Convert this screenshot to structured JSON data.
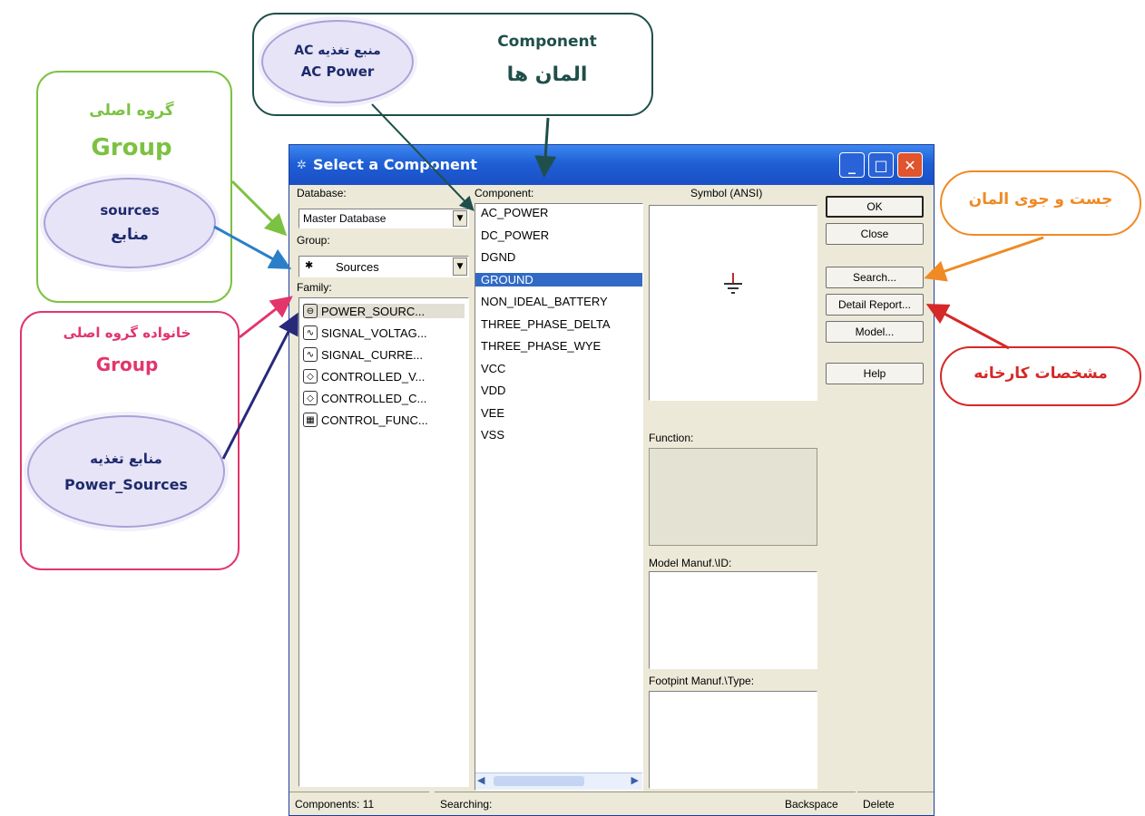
{
  "window": {
    "title": "Select a Component",
    "database_label": "Database:",
    "database_value": "Master Database",
    "group_label": "Group:",
    "group_value": "Sources",
    "family_label": "Family:",
    "component_label": "Component:",
    "symbol_label": "Symbol (ANSI)",
    "function_label": "Function:",
    "model_label": "Model Manuf.\\ID:",
    "footprint_label": "Footpint Manuf.\\Type:",
    "families": [
      {
        "label": "POWER_SOURC...",
        "icon": "power-source-icon",
        "glyph": "⊖"
      },
      {
        "label": "SIGNAL_VOLTAG...",
        "icon": "signal-voltage-icon",
        "glyph": "∿"
      },
      {
        "label": "SIGNAL_CURRE...",
        "icon": "signal-current-icon",
        "glyph": "∿"
      },
      {
        "label": "CONTROLLED_V...",
        "icon": "controlled-voltage-icon",
        "glyph": "◇"
      },
      {
        "label": "CONTROLLED_C...",
        "icon": "controlled-current-icon",
        "glyph": "◇"
      },
      {
        "label": "CONTROL_FUNC...",
        "icon": "control-function-icon",
        "glyph": "▦"
      }
    ],
    "components": [
      "AC_POWER",
      "DC_POWER",
      "DGND",
      "GROUND",
      "NON_IDEAL_BATTERY",
      "THREE_PHASE_DELTA",
      "THREE_PHASE_WYE",
      "VCC",
      "VDD",
      "VEE",
      "VSS"
    ],
    "selected_component": "GROUND",
    "buttons": {
      "ok": "OK",
      "close": "Close",
      "search": "Search...",
      "detail": "Detail Report...",
      "model": "Model...",
      "help": "Help"
    },
    "status": {
      "components": "Components: 11",
      "searching": "Searching:",
      "backspace": "Backspace",
      "delete": "Delete"
    }
  },
  "annotations": {
    "component_en": "Component",
    "component_fa": "المان ها",
    "ac_fa": "منبع تغذیه AC",
    "ac_en": "AC Power",
    "group_fa": "گروه اصلی",
    "group_en": "Group",
    "sources_en": "sources",
    "sources_fa": "منابع",
    "family_fa": "خانواده گروه اصلی",
    "family_en": "Group",
    "power_fa": "منابع تغذیه",
    "power_en": "Power_Sources",
    "search_fa": "جست و جوی المان",
    "detail_fa": "مشخصات کارخانه"
  },
  "colors": {
    "green": "#7cc242",
    "pink": "#e2356b",
    "orange": "#f08a24",
    "red": "#d62828",
    "teal": "#1f4f4a",
    "blue": "#2a7fc8",
    "navy": "#28297a",
    "selection": "#316ac5"
  }
}
